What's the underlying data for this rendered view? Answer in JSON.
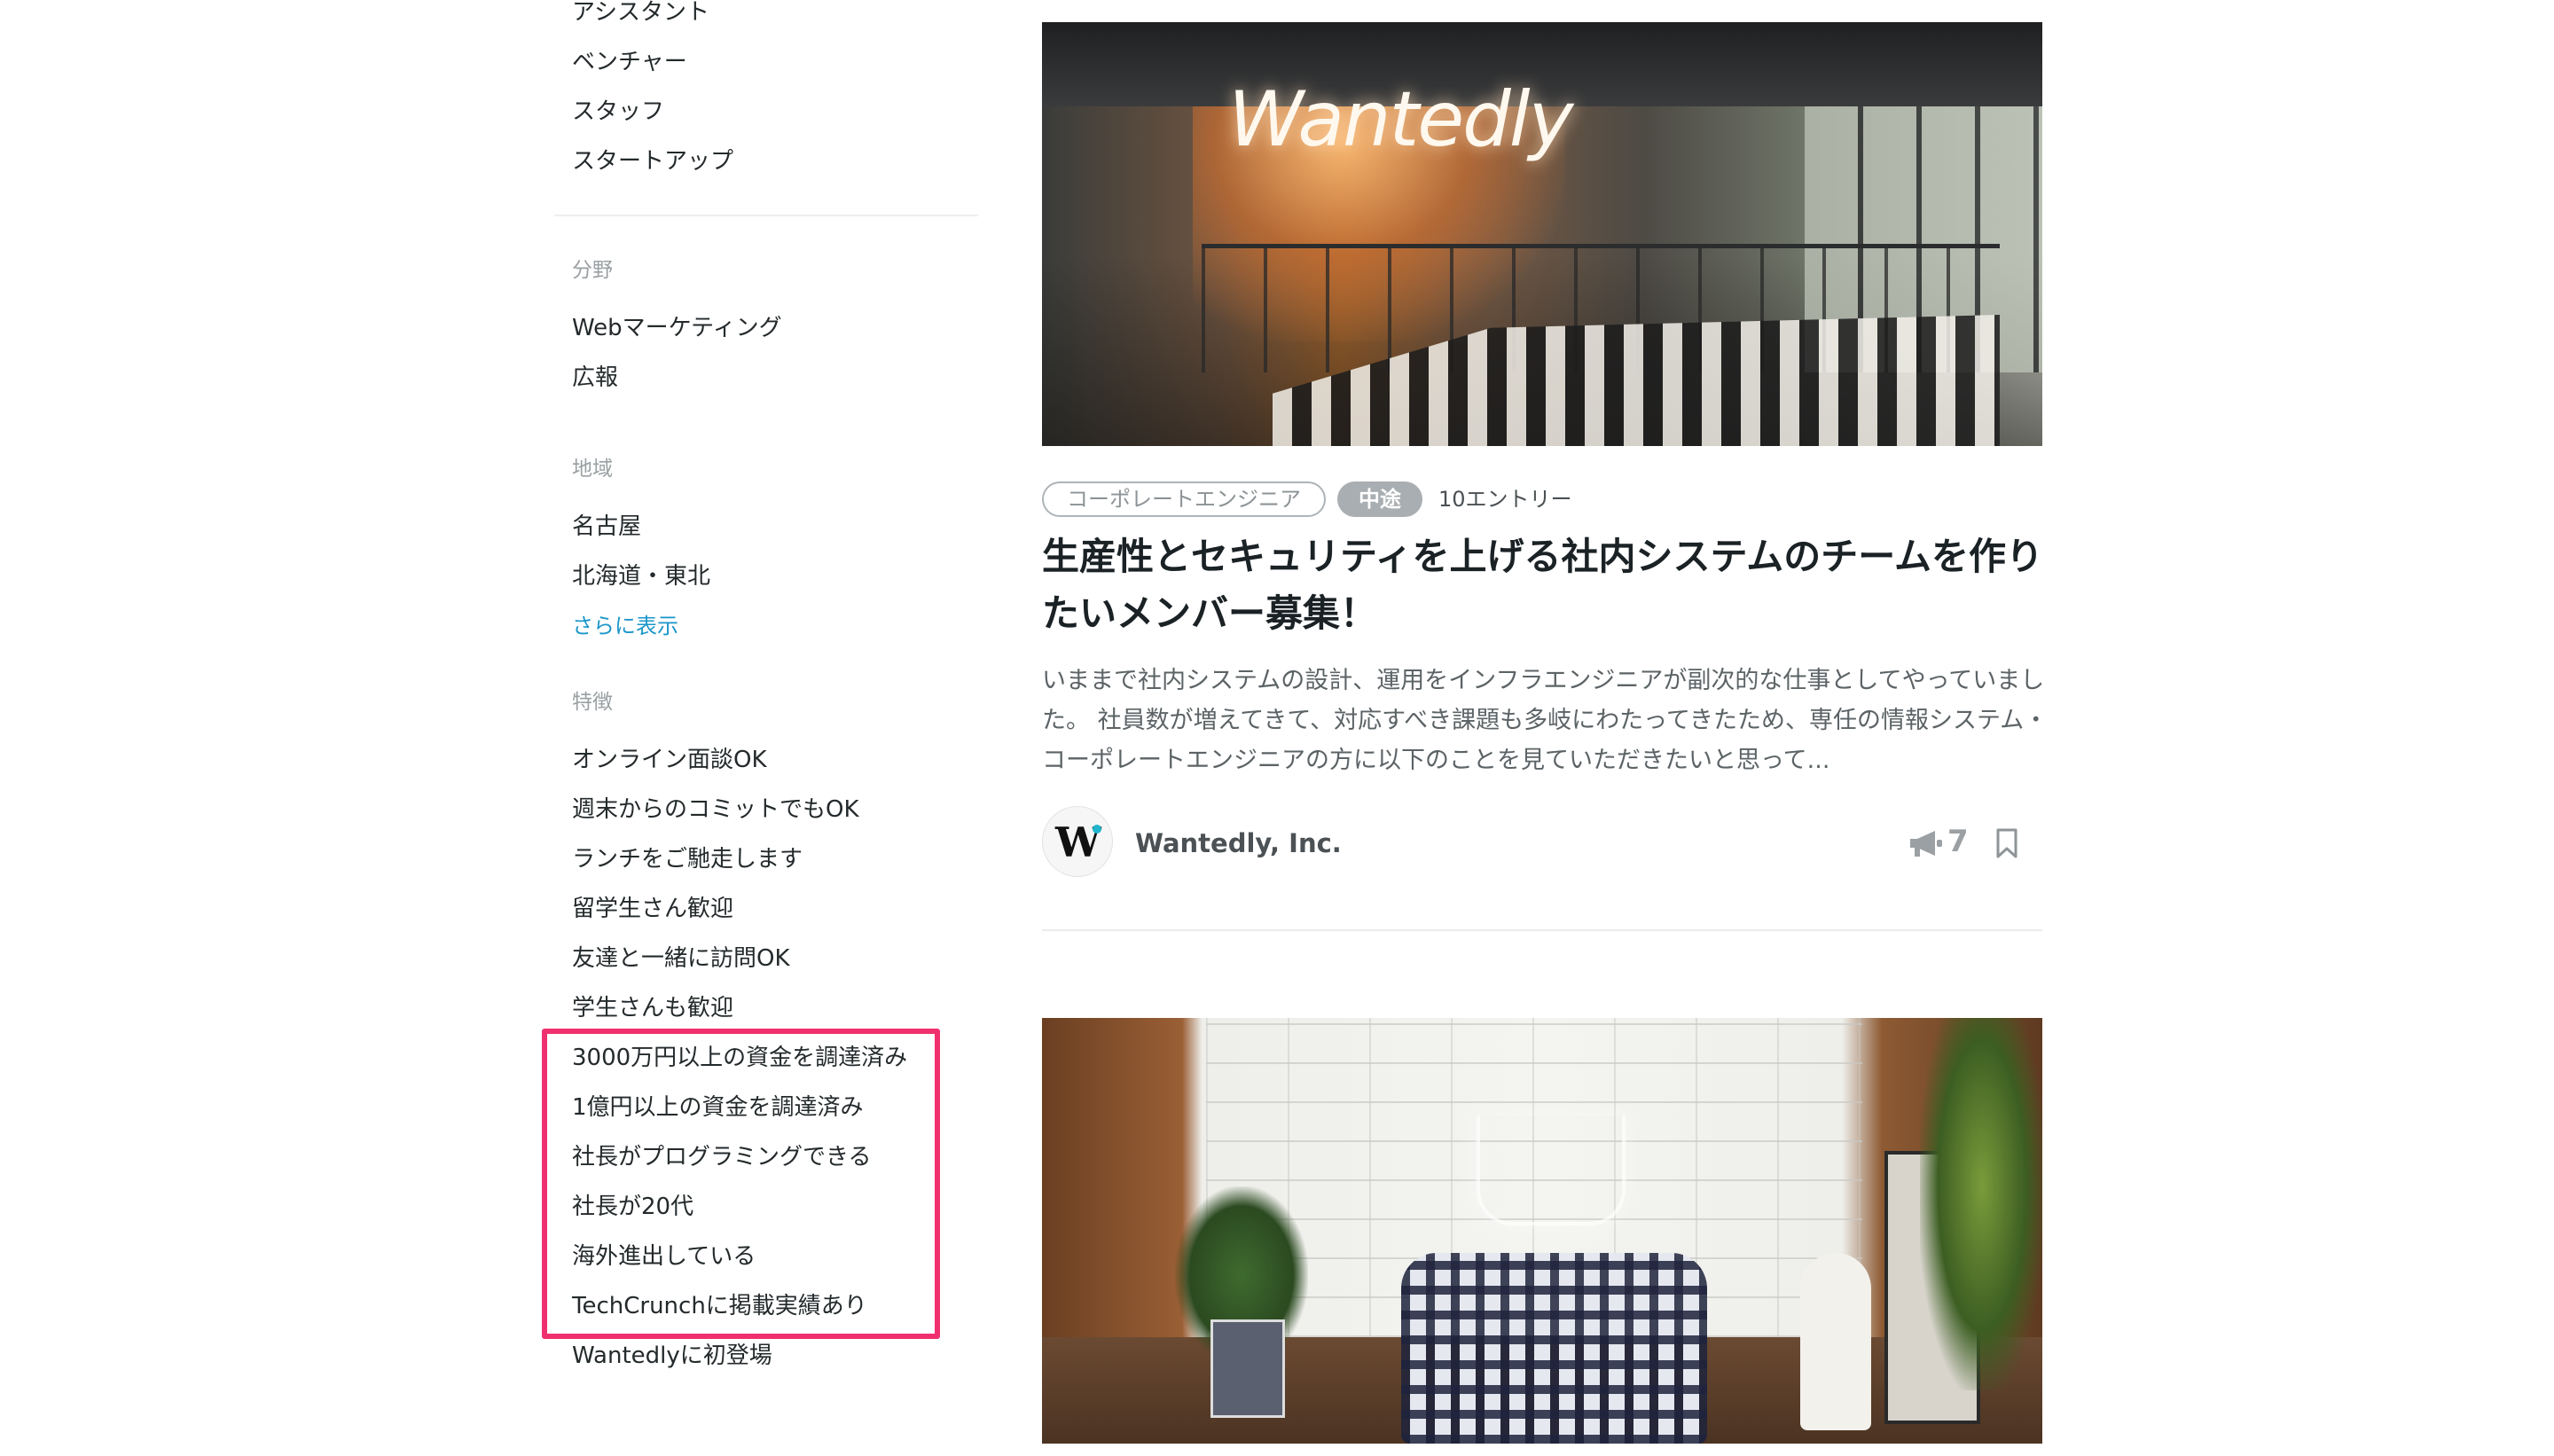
{
  "sidebar": {
    "occupation_items": [
      "アシスタント",
      "ベンチャー",
      "スタッフ",
      "スタートアップ"
    ],
    "field_heading": "分野",
    "field_items": [
      "Webマーケティング",
      "広報"
    ],
    "region_heading": "地域",
    "region_items": [
      "名古屋",
      "北海道・東北"
    ],
    "show_more": "さらに表示",
    "features_heading": "特徴",
    "feature_items": [
      "オンライン面談OK",
      "週末からのコミットでもOK",
      "ランチをご馳走します",
      "留学生さん歓迎",
      "友達と一緒に訪問OK",
      "学生さんも歓迎",
      "3000万円以上の資金を調達済み",
      "1億円以上の資金を調達済み",
      "社長がプログラミングできる",
      "社長が20代",
      "海外進出している",
      "TechCrunchに掲載実績あり",
      "Wantedlyに初登場"
    ],
    "highlight_color": "#f0306e",
    "link_color": "#1a96c9"
  },
  "card1": {
    "image_neon_text": "Wantedly",
    "tag_role": "コーポレートエンジニア",
    "tag_type": "中途",
    "entries": "10エントリー",
    "title": "生産性とセキュリティを上げる社内システムのチームを作りたいメンバー募集！",
    "excerpt": "いままで社内システムの設計、運用をインフラエンジニアが副次的な仕事としてやっていました。 社員数が増えてきて、対応すべき課題も多岐にわたってきたため、専任の情報システム・コーポレートエンジニアの方に以下のことを見ていただきたいと思って...",
    "company_name": "Wantedly, Inc.",
    "cheer_count": "7",
    "icons": {
      "logo": "wantedly-logo",
      "cheer": "megaphone-icon",
      "save": "bookmark-icon"
    }
  }
}
